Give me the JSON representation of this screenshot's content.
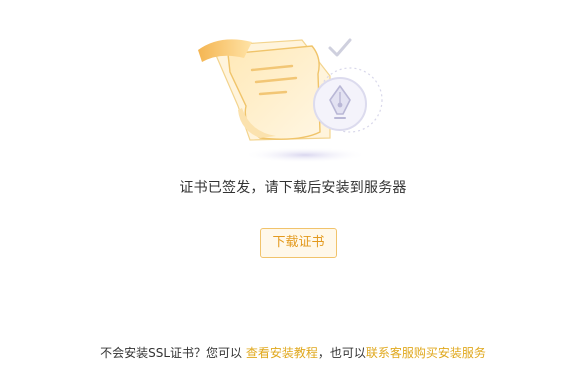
{
  "message": "证书已签发，请下载后安装到服务器",
  "download_button": {
    "label": "下载证书"
  },
  "help": {
    "prefix": "不会安装SSL证书？您可以 ",
    "link_tutorial": "查看安装教程",
    "middle": "，也可以",
    "link_service": "联系客服购买安装服务"
  },
  "colors": {
    "accent": "#e39a1f",
    "link": "#e0a81d",
    "button_border": "#f1c36b",
    "button_bg": "#fff8ea"
  },
  "icons": [
    "document-icon",
    "pen-nib-seal-icon",
    "checkmark-icon"
  ]
}
